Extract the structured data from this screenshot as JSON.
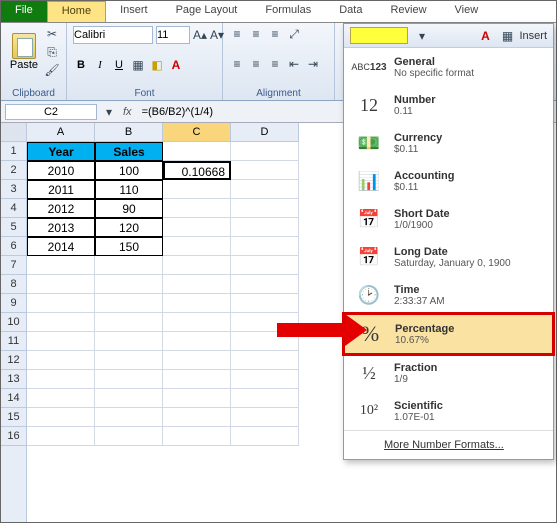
{
  "tabs": {
    "file": "File",
    "home": "Home",
    "insert": "Insert",
    "pagelayout": "Page Layout",
    "formulas": "Formulas",
    "data": "Data",
    "review": "Review",
    "view": "View"
  },
  "ribbon": {
    "paste": "Paste",
    "clipboard": "Clipboard",
    "font_name": "Calibri",
    "font_size": "11",
    "font_group": "Font",
    "align_group": "Alignment",
    "insert_btn": "Insert"
  },
  "namebox": "C2",
  "formula": "=(B6/B2)^(1/4)",
  "cols": [
    "A",
    "B",
    "C",
    "D"
  ],
  "rows": [
    "1",
    "2",
    "3",
    "4",
    "5",
    "6",
    "7",
    "8",
    "9",
    "10",
    "11",
    "12",
    "13",
    "14",
    "15",
    "16"
  ],
  "table": {
    "h1": "Year",
    "h2": "Sales",
    "r2a": "2010",
    "r2b": "100",
    "r2c": "0.10668",
    "r3a": "2011",
    "r3b": "110",
    "r4a": "2012",
    "r4b": "90",
    "r5a": "2013",
    "r5b": "120",
    "r6a": "2014",
    "r6b": "150"
  },
  "dd": {
    "general": {
      "t": "General",
      "s": "No specific format"
    },
    "number": {
      "t": "Number",
      "s": "0.11"
    },
    "currency": {
      "t": "Currency",
      "s": "$0.11"
    },
    "accounting": {
      "t": "Accounting",
      "s": "$0.11"
    },
    "shortdate": {
      "t": "Short Date",
      "s": "1/0/1900"
    },
    "longdate": {
      "t": "Long Date",
      "s": "Saturday, January 0, 1900"
    },
    "time": {
      "t": "Time",
      "s": "2:33:37 AM"
    },
    "percentage": {
      "t": "Percentage",
      "s": "10.67%"
    },
    "fraction": {
      "t": "Fraction",
      "s": "1/9"
    },
    "scientific": {
      "t": "Scientific",
      "s": "1.07E-01"
    },
    "more": "More Number Formats..."
  }
}
